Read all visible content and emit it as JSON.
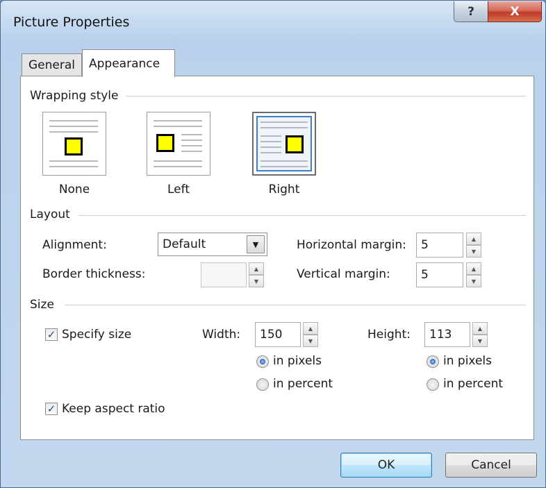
{
  "window": {
    "title": "Picture Properties",
    "help_glyph": "?",
    "close_glyph": "X"
  },
  "tabs": [
    {
      "label": "General",
      "selected": false
    },
    {
      "label": "Appearance",
      "selected": true
    }
  ],
  "wrapping": {
    "group_label": "Wrapping style",
    "options": [
      {
        "label": "None",
        "selected": false
      },
      {
        "label": "Left",
        "selected": false
      },
      {
        "label": "Right",
        "selected": true
      }
    ]
  },
  "layout": {
    "group_label": "Layout",
    "alignment_label": "Alignment:",
    "alignment_value": "Default",
    "border_label": "Border thickness:",
    "border_value": "",
    "hmargin_label": "Horizontal margin:",
    "hmargin_value": "5",
    "vmargin_label": "Vertical margin:",
    "vmargin_value": "5"
  },
  "size": {
    "group_label": "Size",
    "specify_label": "Specify size",
    "specify_checked": true,
    "width_label": "Width:",
    "width_value": "150",
    "height_label": "Height:",
    "height_value": "113",
    "width_unit": {
      "pixels_label": "in pixels",
      "percent_label": "in percent",
      "selected": "pixels"
    },
    "height_unit": {
      "pixels_label": "in pixels",
      "percent_label": "in percent",
      "selected": "pixels"
    },
    "keep_aspect_label": "Keep aspect ratio",
    "keep_aspect_checked": true
  },
  "buttons": {
    "ok_label": "OK",
    "cancel_label": "Cancel"
  },
  "colors": {
    "selection_accent": "#3c7fd0",
    "picture_fill": "#ffff00",
    "close_button": "#c0392b"
  },
  "icons": {
    "check_glyph": "✓",
    "dropdown_glyph": "▼",
    "spin_up_glyph": "▲",
    "spin_down_glyph": "▼"
  }
}
